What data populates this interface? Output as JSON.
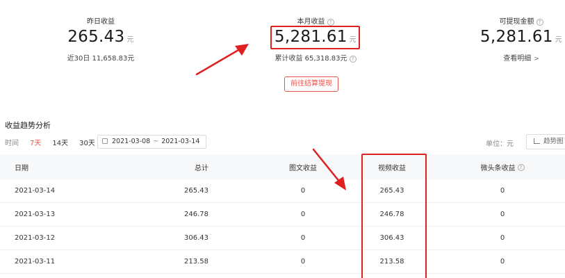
{
  "stats": {
    "yesterday": {
      "label": "昨日收益",
      "value": "265.43",
      "unit": "元",
      "sub": "近30日 11,658.83元"
    },
    "month": {
      "label": "本月收益",
      "value": "5,281.61",
      "unit": "元",
      "sub": "累计收益 65,318.83元"
    },
    "withdrawable": {
      "label": "可提现金额",
      "value": "5,281.61",
      "unit": "元",
      "sub": "查看明细"
    }
  },
  "settle_button": "前往结算提现",
  "trend": {
    "title": "收益趋势分析",
    "time_label": "时间",
    "options": [
      "7天",
      "14天",
      "30天"
    ],
    "active_option": "7天",
    "date_start": "2021-03-08",
    "date_sep": "~",
    "date_end": "2021-03-14",
    "unit_label": "单位：元",
    "chart_button": "趋势图"
  },
  "table": {
    "headers": [
      "日期",
      "总计",
      "图文收益",
      "视频收益",
      "微头条收益"
    ],
    "rows": [
      [
        "2021-03-14",
        "265.43",
        "0",
        "265.43",
        "0"
      ],
      [
        "2021-03-13",
        "246.78",
        "0",
        "246.78",
        "0"
      ],
      [
        "2021-03-12",
        "306.43",
        "0",
        "306.43",
        "0"
      ],
      [
        "2021-03-11",
        "213.58",
        "0",
        "213.58",
        "0"
      ]
    ]
  },
  "colors": {
    "accent": "#e8554e",
    "annotation_red": "#e02020",
    "header_bg": "#f7f8fa"
  },
  "icons": [
    "help-circle-icon",
    "chevron-right-icon",
    "calendar-icon",
    "line-chart-icon",
    "annotation-arrow"
  ]
}
